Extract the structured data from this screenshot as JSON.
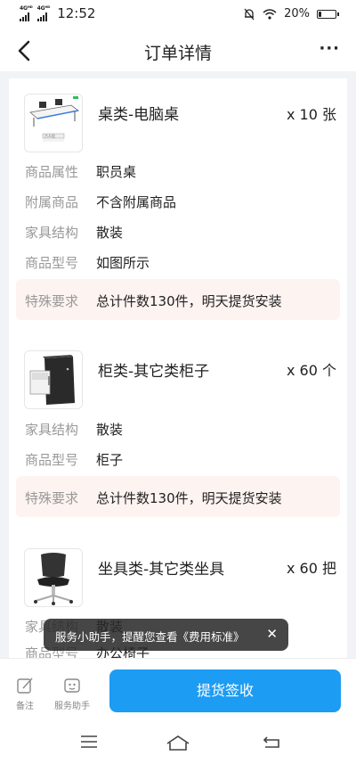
{
  "status": {
    "network1": "4G",
    "network2": "4G",
    "time": "12:52",
    "battery": "20%",
    "battery_level": 0.2
  },
  "nav": {
    "title": "订单详情",
    "more": "···"
  },
  "products": [
    {
      "name": "桌类-电脑桌",
      "qty": "x 10 张",
      "thumb_caption": "六人位",
      "attrs": [
        {
          "k": "商品属性",
          "v": "职员桌"
        },
        {
          "k": "附属商品",
          "v": "不含附属商品"
        },
        {
          "k": "家具结构",
          "v": "散装"
        },
        {
          "k": "商品型号",
          "v": "如图所示"
        }
      ],
      "special": {
        "k": "特殊要求",
        "v": "总计件数130件，明天提货安装"
      }
    },
    {
      "name": "柜类-其它类柜子",
      "qty": "x 60 个",
      "attrs": [
        {
          "k": "家具结构",
          "v": "散装"
        },
        {
          "k": "商品型号",
          "v": "柜子"
        }
      ],
      "special": {
        "k": "特殊要求",
        "v": "总计件数130件，明天提货安装"
      }
    },
    {
      "name": "坐具类-其它类坐具",
      "qty": "x 60 把",
      "attrs": [
        {
          "k": "家具结构",
          "v": "散装"
        },
        {
          "k": "商品型号",
          "v": "办公椅子"
        }
      ]
    }
  ],
  "toast": {
    "text": "服务小助手，提醒您查看《费用标准》",
    "close": "✕"
  },
  "bottom": {
    "remark": "备注",
    "assistant": "服务助手",
    "submit": "提货签收"
  },
  "colors": {
    "accent": "#1d9cf3",
    "special_bg": "#fdf3f0"
  }
}
